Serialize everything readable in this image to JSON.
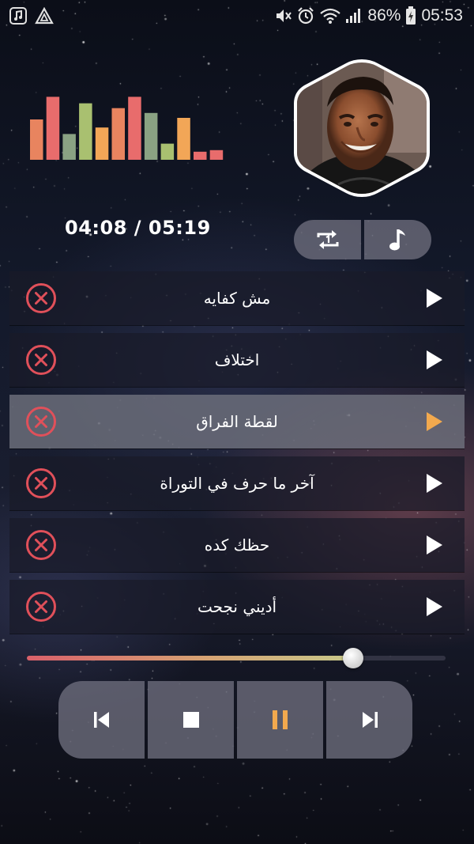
{
  "status_bar": {
    "battery": "86%",
    "time": "05:53",
    "left_icons": [
      "music-note-icon",
      "triangle-app-icon"
    ],
    "right_icons": [
      "mute-icon",
      "alarm-icon",
      "wifi-icon",
      "signal-icon",
      "battery-icon"
    ]
  },
  "player": {
    "time_display": "04:08 / 05:19",
    "equalizer_levels": [
      0.5,
      0.78,
      0.32,
      0.7,
      0.4,
      0.64,
      0.78,
      0.58,
      0.2,
      0.52,
      0.1,
      0.12
    ],
    "progress": 0.78,
    "equalizer_colors": [
      "#e8845f",
      "#e86c6c",
      "#8aa283",
      "#a9c070",
      "#f2a657",
      "#e8845f",
      "#e86c6c",
      "#8aa283",
      "#a9c070",
      "#f2a657",
      "#e86c6c",
      "#e86c6c"
    ]
  },
  "playlist": [
    {
      "title": "مش كفايه",
      "active": false
    },
    {
      "title": "اختلاف",
      "active": false
    },
    {
      "title": "لقطة الفراق",
      "active": true
    },
    {
      "title": "آخر ما حرف في التوراة",
      "active": false
    },
    {
      "title": "حظك كده",
      "active": false
    },
    {
      "title": "أديني نجحت",
      "active": false
    }
  ],
  "colors": {
    "accent": "#f2a94e",
    "remove": "#e0505a",
    "play": "#ffffff"
  },
  "icons": {
    "repeat": "repeat-one-icon",
    "playlist": "music-note-icon",
    "remove": "remove-circle-icon",
    "play": "play-icon",
    "previous": "skip-previous-icon",
    "stop": "stop-icon",
    "pause": "pause-icon",
    "next": "skip-next-icon"
  }
}
